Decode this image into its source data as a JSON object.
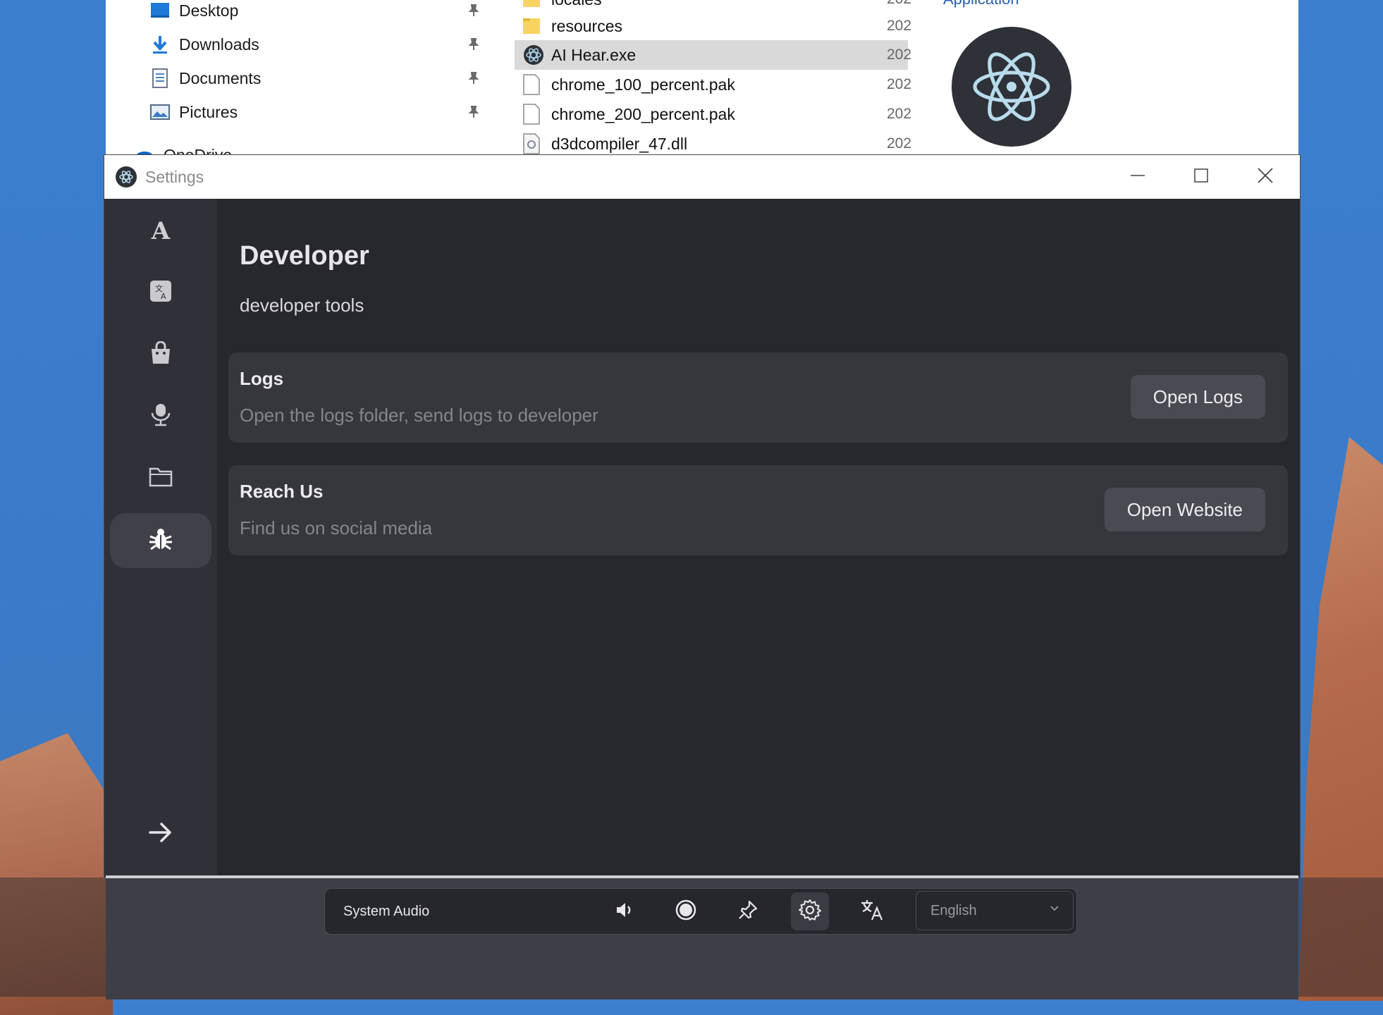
{
  "explorer": {
    "nav_items": [
      {
        "label": "Desktop",
        "icon": "desktop-icon"
      },
      {
        "label": "Downloads",
        "icon": "download-icon"
      },
      {
        "label": "Documents",
        "icon": "documents-icon"
      },
      {
        "label": "Pictures",
        "icon": "pictures-icon"
      }
    ],
    "nav_partial": "OneDrive",
    "files": [
      {
        "name": "locales",
        "date": "202",
        "type": "folder"
      },
      {
        "name": "resources",
        "date": "202",
        "type": "folder"
      },
      {
        "name": "AI Hear.exe",
        "date": "202",
        "type": "exe",
        "selected": true
      },
      {
        "name": "chrome_100_percent.pak",
        "date": "202",
        "type": "file"
      },
      {
        "name": "chrome_200_percent.pak",
        "date": "202",
        "type": "file"
      },
      {
        "name": "d3dcompiler_47.dll",
        "date": "202",
        "type": "dll"
      }
    ],
    "preview_type": "Application"
  },
  "settings": {
    "window_title": "Settings",
    "sidebar": {
      "items": [
        {
          "name": "appearance",
          "icon": "font-letter-icon",
          "letter": "A"
        },
        {
          "name": "translation",
          "icon": "translate-box-icon"
        },
        {
          "name": "store",
          "icon": "shopping-bag-icon"
        },
        {
          "name": "audio",
          "icon": "microphone-icon"
        },
        {
          "name": "files",
          "icon": "folder-icon"
        },
        {
          "name": "developer",
          "icon": "bug-icon",
          "active": true
        }
      ],
      "exit_icon": "arrow-right-icon"
    },
    "page": {
      "title": "Developer",
      "subtitle": "developer tools"
    },
    "cards": [
      {
        "title": "Logs",
        "description": "Open the logs folder, send logs to developer",
        "button": "Open Logs"
      },
      {
        "title": "Reach Us",
        "description": "Find us on social media",
        "button": "Open Website"
      }
    ]
  },
  "toolbar": {
    "source": "System Audio",
    "icons": [
      "speaker-icon",
      "record-icon",
      "pin-icon",
      "gear-icon",
      "translate-icon"
    ],
    "language": "English"
  },
  "colors": {
    "window_bg": "#27282e",
    "sidebar_bg": "#2f3038",
    "card_bg": "#36373d",
    "button_bg": "#4a4b52"
  }
}
